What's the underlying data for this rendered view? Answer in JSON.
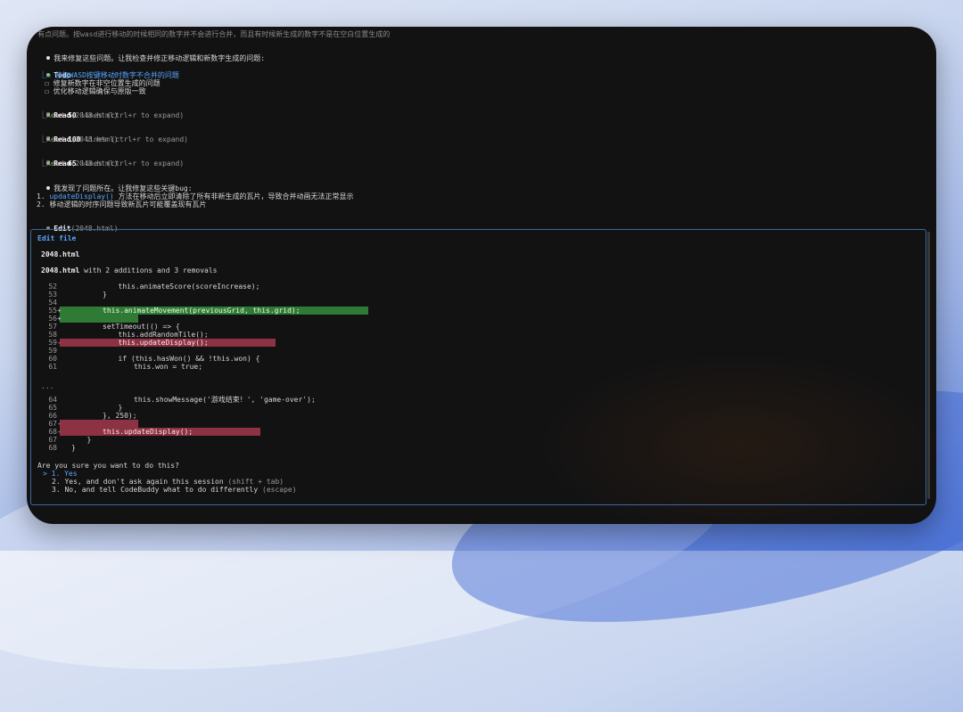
{
  "header_text": "有点问题。按wasd进行移动的时候相同的数字并不会进行合并，而且有时候新生成的数字不是在空白位置生成的",
  "msg1": "我来修复这些问题。让我检查并修正移动逻辑和新数字生成的问题:",
  "todo": {
    "title": "Todo",
    "items": [
      "修复WASD按键移动时数字不合并的问题",
      "修复新数字在非空位置生成的问题",
      "优化移动逻辑确保与原版一致"
    ]
  },
  "reads": [
    {
      "tool": "Read",
      "file": "(2048.html)",
      "prefix": "Read ",
      "count": "50",
      "suffix": " lines (ctrl+r to expand)"
    },
    {
      "tool": "Read",
      "file": "(2048.html)",
      "prefix": "Read ",
      "count": "100",
      "suffix": " lines (ctrl+r to expand)"
    },
    {
      "tool": "Read",
      "file": "(2048.html)",
      "prefix": "Read ",
      "count": "65",
      "suffix": " lines (ctrl+r to expand)"
    }
  ],
  "msg2": "我发现了问题所在。让我修复这些关键bug:",
  "bugs": [
    {
      "num": "1.",
      "code": "updateDisplay()",
      "text": " 方法在移动后立即清除了所有非新生成的瓦片，导致合并动画无法正常显示"
    },
    {
      "num": "2.",
      "code": "",
      "text": "移动逻辑的时序问题导致新瓦片可能覆盖现有瓦片"
    }
  ],
  "edit": {
    "tool": "Edit",
    "file": "(2048.html)"
  },
  "panel": {
    "title": "Edit file",
    "filename": "2048.html",
    "summary_file": "2048.html",
    "summary_rest": " with 2 additions and 3 removals",
    "ellipsis": "...",
    "diff": [
      {
        "n": "52",
        "s": "",
        "t": "this.animateScore(scoreIncrease);",
        "ind": 3,
        "k": ""
      },
      {
        "n": "53",
        "s": "",
        "t": "}",
        "ind": 2,
        "k": ""
      },
      {
        "n": "54",
        "s": "",
        "t": "",
        "ind": 0,
        "k": ""
      },
      {
        "n": "55",
        "s": "+",
        "t": "this.animateMovement(previousGrid, this.grid);",
        "ind": 2,
        "k": "add"
      },
      {
        "n": "56",
        "s": "+",
        "t": "",
        "ind": 0,
        "k": "add"
      },
      {
        "n": "57",
        "s": "",
        "t": "setTimeout(() => {",
        "ind": 2,
        "k": ""
      },
      {
        "n": "58",
        "s": "",
        "t": "this.addRandomTile();",
        "ind": 3,
        "k": ""
      },
      {
        "n": "59",
        "s": "-",
        "t": "this.updateDisplay();",
        "ind": 3,
        "k": "del"
      },
      {
        "n": "59",
        "s": "",
        "t": "",
        "ind": 0,
        "k": ""
      },
      {
        "n": "60",
        "s": "",
        "t": "if (this.hasWon() && !this.won) {",
        "ind": 3,
        "k": ""
      },
      {
        "n": "61",
        "s": "",
        "t": "this.won = true;",
        "ind": 4,
        "k": ""
      }
    ],
    "diff2": [
      {
        "n": "64",
        "s": "",
        "t": "this.showMessage('游戏结束！', 'game-over');",
        "ind": 4,
        "k": ""
      },
      {
        "n": "65",
        "s": "",
        "t": "}",
        "ind": 3,
        "k": ""
      },
      {
        "n": "66",
        "s": "",
        "t": "}, 250);",
        "ind": 2,
        "k": ""
      },
      {
        "n": "67",
        "s": "-",
        "t": "",
        "ind": 0,
        "k": "del"
      },
      {
        "n": "68",
        "s": "-",
        "t": "this.updateDisplay();",
        "ind": 2,
        "k": "del"
      },
      {
        "n": "67",
        "s": "",
        "t": "}",
        "ind": 1,
        "k": ""
      },
      {
        "n": "68",
        "s": "",
        "t": "}",
        "ind": 0,
        "k": ""
      }
    ],
    "question": "Are you sure you want to do this?",
    "options": [
      {
        "marker": "> ",
        "label": "1. Yes",
        "hint": ""
      },
      {
        "marker": "",
        "label": "2. Yes, and don't ask again this session",
        "hint": " (shift + tab)"
      },
      {
        "marker": "",
        "label": "3. No, and tell CodeBuddy what to do differently",
        "hint": " (escape)"
      }
    ]
  }
}
